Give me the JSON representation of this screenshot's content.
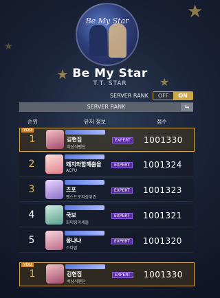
{
  "song": {
    "title": "Be My Star",
    "artist": "T.T. STAR",
    "jacket_text": "Be My Star"
  },
  "toggle": {
    "label": "SERVER RANK",
    "off": "OFF",
    "on": "ON"
  },
  "ranking_header": {
    "title": "SERVER RANK",
    "sort_icon": "swap-icon"
  },
  "columns": {
    "rank": "순위",
    "user": "유저 정보",
    "score": "점수"
  },
  "you_label": "YOU",
  "rows": [
    {
      "rank": "1",
      "name": "김현집",
      "team": "비상식팬단",
      "difficulty": "EXPERT",
      "score": "1001330",
      "lvl": ""
    },
    {
      "rank": "2",
      "name": "돼지와함께춤을",
      "team": "ACPU",
      "difficulty": "EXPERT",
      "score": "1001324",
      "lvl": ""
    },
    {
      "rank": "3",
      "name": "츠포",
      "team": "엔스드로지상위권",
      "difficulty": "EXPERT",
      "score": "1001323",
      "lvl": ""
    },
    {
      "rank": "4",
      "name": "국보",
      "team": "화이팅이세들",
      "difficulty": "EXPERT",
      "score": "1001321",
      "lvl": ""
    },
    {
      "rank": "5",
      "name": "웅냐냐",
      "team": "스타맘",
      "difficulty": "EXPERT",
      "score": "1001320",
      "lvl": ""
    }
  ],
  "my_row": {
    "rank": "1",
    "name": "김현집",
    "team": "비상식팬단",
    "difficulty": "EXPERT",
    "score": "1001330"
  }
}
